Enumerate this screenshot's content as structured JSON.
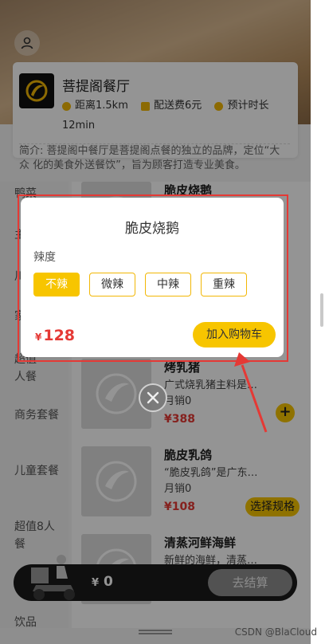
{
  "shop": {
    "name": "菩提阁餐厅",
    "distance": "距离1.5km",
    "delivery_fee": "配送费6元",
    "eta_label": "预计时长",
    "eta_value": "12min",
    "intro": "简介: 菩提阁中餐厅是菩提阁点餐的独立的品牌，定位“大众 化的美食外送餐饮”，旨为顾客打造专业美食。"
  },
  "sidebar": {
    "items": [
      {
        "label": "鸭菜"
      },
      {
        "label": "主"
      },
      {
        "label": "川"
      },
      {
        "label": "家"
      },
      {
        "label": "超值\n人餐"
      },
      {
        "label": "商务套餐"
      },
      {
        "label": "儿童套餐"
      },
      {
        "label": "超值8人餐"
      },
      {
        "label": "饮品"
      }
    ]
  },
  "dishes": [
    {
      "name": "脆皮烧鹅",
      "desc": "",
      "sales": "",
      "price": ""
    },
    {
      "name": "烤乳猪",
      "desc": "广式烧乳猪主料是…",
      "sales": "月销0",
      "price": "388",
      "action": "+"
    },
    {
      "name": "脆皮乳鸽",
      "desc": "“脆皮乳鸽”是广东…",
      "sales": "月销0",
      "price": "108",
      "action": "选择规格"
    },
    {
      "name": "清蒸河鲜海鲜",
      "desc": "新鲜的海鲜，清蒸…",
      "sales": "",
      "price": ""
    }
  ],
  "cart": {
    "currency": "¥",
    "total": "0",
    "checkout_label": "去结算"
  },
  "modal": {
    "title": "脆皮烧鹅",
    "spice_label": "辣度",
    "options": [
      "不辣",
      "微辣",
      "中辣",
      "重辣"
    ],
    "selected_option": "不辣",
    "currency": "¥",
    "price": "128",
    "add_to_cart_label": "加入购物车"
  },
  "watermark": "CSDN @BlaCloud",
  "colors": {
    "accent": "#f7c500",
    "price": "#e53935",
    "highlight_outline": "#e53935",
    "dark_bar": "#1a1a1a"
  },
  "icons": [
    "user-icon",
    "shop-logo-icon",
    "clock-icon",
    "bag-icon",
    "navigation-icon",
    "food-placeholder-icon",
    "rider-icon",
    "close-icon",
    "annotation-arrow"
  ]
}
